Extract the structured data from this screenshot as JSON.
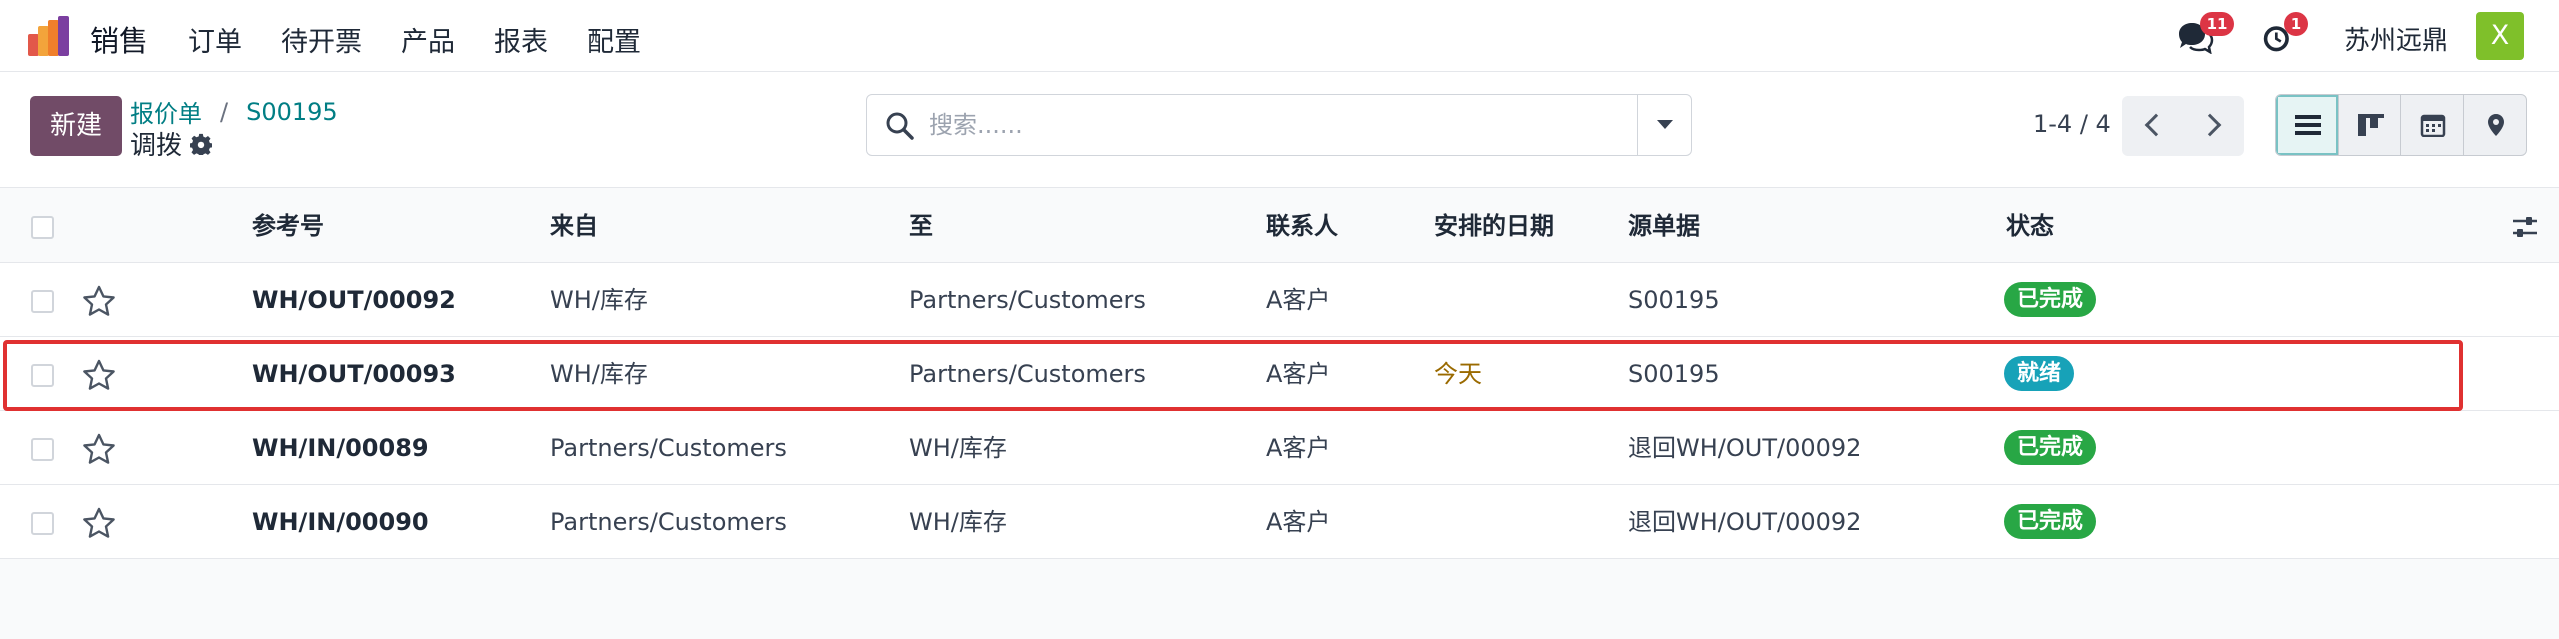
{
  "nav": {
    "app_name": "销售",
    "menu": [
      "订单",
      "待开票",
      "产品",
      "报表",
      "配置"
    ],
    "messages_count": "11",
    "activities_count": "1",
    "company": "苏州远鼎",
    "avatar_letter": "X",
    "colors": {
      "badge": "#dc3545",
      "avatar": "#7fc02a",
      "brand": "#714b67"
    }
  },
  "control": {
    "new_label": "新建",
    "breadcrumb_parent": "报价单",
    "breadcrumb_sep": "/",
    "breadcrumb_current": "S00195",
    "subtitle": "调拨",
    "search_placeholder": "搜索......",
    "pager": "1-4 / 4",
    "views": [
      "list-view-icon",
      "kanban-view-icon",
      "calendar-view-icon",
      "map-view-icon"
    ],
    "active_view": "list-view-icon"
  },
  "table": {
    "columns": [
      "参考号",
      "来自",
      "至",
      "联系人",
      "安排的日期",
      "源单据",
      "状态"
    ],
    "rows": [
      {
        "ref": "WH/OUT/00092",
        "from": "WH/库存",
        "to": "Partners/Customers",
        "contact": "A客户",
        "date": "",
        "source": "S00195",
        "status": "已完成",
        "status_color": "#28a745"
      },
      {
        "ref": "WH/OUT/00093",
        "from": "WH/库存",
        "to": "Partners/Customers",
        "contact": "A客户",
        "date": "今天",
        "source": "S00195",
        "status": "就绪",
        "status_color": "#17a2b8"
      },
      {
        "ref": "WH/IN/00089",
        "from": "Partners/Customers",
        "to": "WH/库存",
        "contact": "A客户",
        "date": "",
        "source": "退回WH/OUT/00092",
        "status": "已完成",
        "status_color": "#28a745"
      },
      {
        "ref": "WH/IN/00090",
        "from": "Partners/Customers",
        "to": "WH/库存",
        "contact": "A客户",
        "date": "",
        "source": "退回WH/OUT/00092",
        "status": "已完成",
        "status_color": "#28a745"
      }
    ],
    "highlight_color": "#e03131"
  }
}
